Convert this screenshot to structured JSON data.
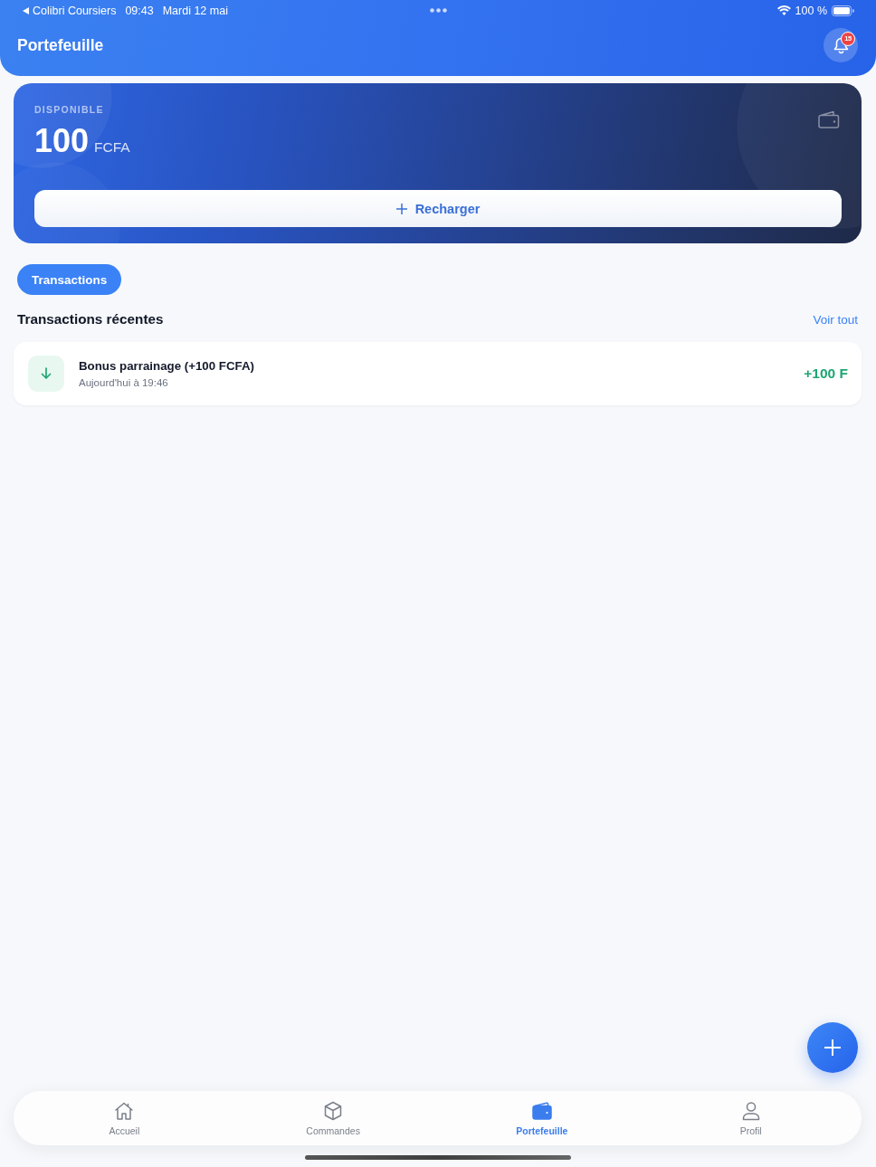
{
  "status_bar": {
    "back_app": "Colibri Coursiers",
    "time": "09:43",
    "date": "Mardi 12 mai",
    "battery": "100 %"
  },
  "header": {
    "title": "Portefeuille",
    "notifications_badge": "15"
  },
  "balance_card": {
    "label": "DISPONIBLE",
    "amount": "100",
    "currency": "FCFA",
    "button": "Recharger"
  },
  "tabs": [
    {
      "label": "Transactions",
      "selected": true
    }
  ],
  "section": {
    "title": "Transactions récentes",
    "link": "Voir tout"
  },
  "transactions": [
    {
      "kind": "credit",
      "title": "Bonus parrainage (+100 FCFA)",
      "time": "Aujourd'hui à 19:46",
      "amount": "+100 F"
    }
  ],
  "bottom_nav": [
    {
      "kind": "home",
      "label": "Accueil",
      "selected": false
    },
    {
      "kind": "orders",
      "label": "Commandes",
      "selected": false
    },
    {
      "kind": "wallet",
      "label": "Portefeuille",
      "selected": true
    },
    {
      "kind": "profile",
      "label": "Profil",
      "selected": false
    }
  ]
}
